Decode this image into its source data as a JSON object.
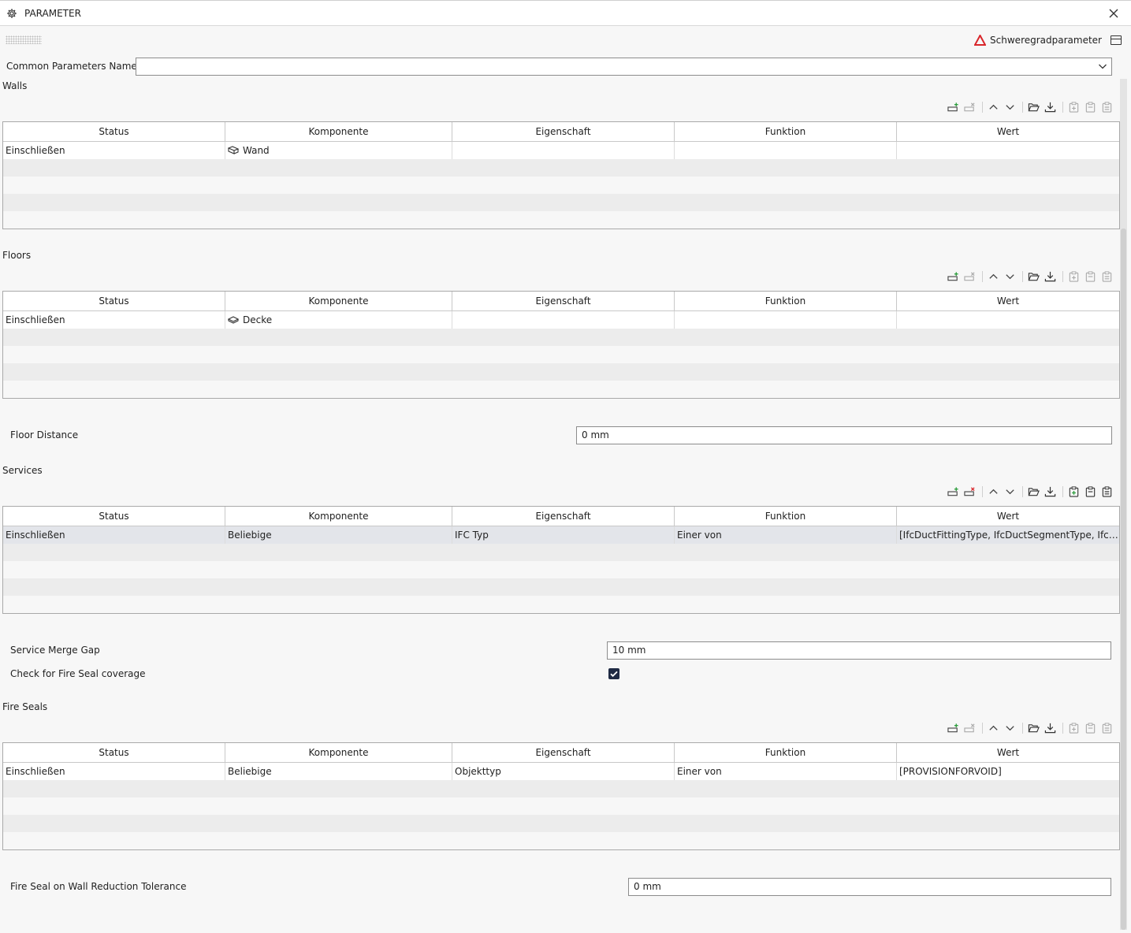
{
  "window": {
    "title": "PARAMETER"
  },
  "header": {
    "severity_label": "Schweregradparameter"
  },
  "common": {
    "label": "Common Parameters Name",
    "value": ""
  },
  "columns": [
    "Status",
    "Komponente",
    "Eigenschaft",
    "Funktion",
    "Wert"
  ],
  "walls": {
    "title": "Walls",
    "rows": [
      {
        "status": "Einschließen",
        "component": "Wand",
        "property": "",
        "function": "",
        "value": ""
      }
    ]
  },
  "floors": {
    "title": "Floors",
    "rows": [
      {
        "status": "Einschließen",
        "component": "Decke",
        "property": "",
        "function": "",
        "value": ""
      }
    ],
    "distance_label": "Floor Distance",
    "distance_value": "0 mm"
  },
  "services": {
    "title": "Services",
    "rows": [
      {
        "status": "Einschließen",
        "component": "Beliebige",
        "property": "IFC Typ",
        "function": "Einer von",
        "value": "[IfcDuctFittingType, IfcDuctSegmentType, IfcDuctSilencerType]"
      }
    ],
    "merge_gap_label": "Service Merge Gap",
    "merge_gap_value": "10 mm",
    "fire_seal_check_label": "Check for Fire Seal coverage",
    "fire_seal_check": true
  },
  "fire_seals": {
    "title": "Fire Seals",
    "rows": [
      {
        "status": "Einschließen",
        "component": "Beliebige",
        "property": "Objekttyp",
        "function": "Einer von",
        "value": "[PROVISIONFORVOID]"
      }
    ],
    "tolerance_label": "Fire Seal on Wall Reduction Tolerance",
    "tolerance_value": "0 mm"
  },
  "colors": {
    "accent_red": "#d9262b",
    "accent_yellow": "#f2b705",
    "add_green": "#2e9e3e",
    "remove_red": "#d9262b"
  },
  "icons": [
    "gear-icon",
    "close-icon",
    "warning-triangle-icon",
    "layout-icon",
    "add-row-icon",
    "remove-row-icon",
    "arrow-up-icon",
    "arrow-down-icon",
    "folder-open-icon",
    "download-icon",
    "clipboard-add-icon",
    "clipboard-icon",
    "clipboard-minus-icon",
    "wall-icon",
    "floor-icon",
    "chevron-down-icon"
  ]
}
